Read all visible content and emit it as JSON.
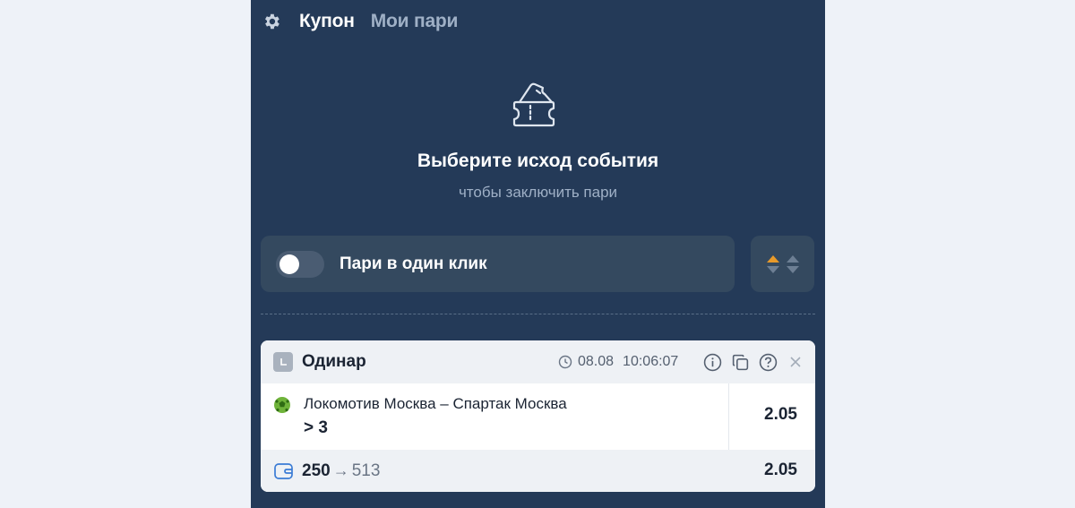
{
  "header": {
    "tabs": [
      {
        "label": "Купон",
        "active": true
      },
      {
        "label": "Мои пари",
        "active": false
      }
    ]
  },
  "empty_state": {
    "icon": "ticket-icon",
    "title": "Выберите исход события",
    "subtitle": "чтобы заключить пари"
  },
  "one_click": {
    "label": "Пари в один клик",
    "enabled": false
  },
  "coupon": {
    "type": "Одинар",
    "date": "08.08",
    "time": "10:06:07",
    "event": {
      "teams": "Локомотив Москва – Спартак Москва",
      "outcome": "> 3",
      "odd": "2.05"
    },
    "stake": "250",
    "arrow": "→",
    "payout": "513",
    "total_odd": "2.05"
  },
  "colors": {
    "panel_bg": "#243a58",
    "page_bg": "#eef2f8",
    "accent_orange": "#e89a2a"
  }
}
